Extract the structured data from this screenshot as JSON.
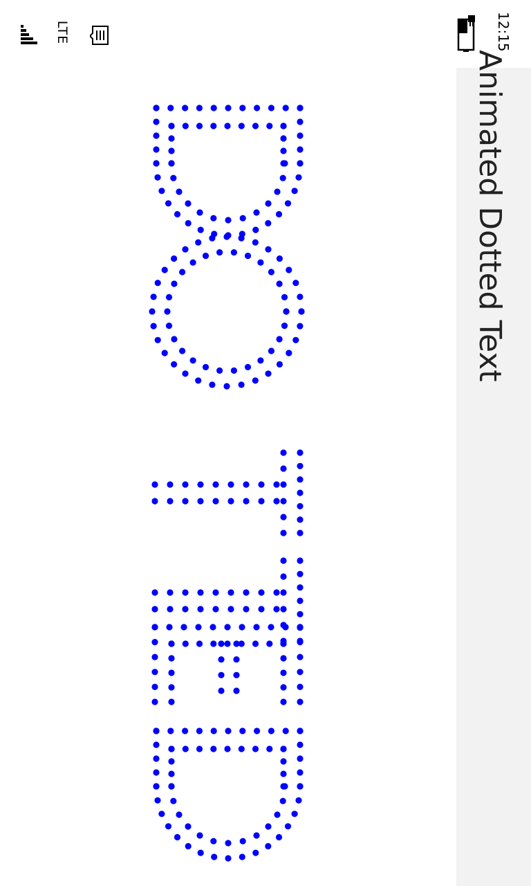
{
  "status_bar": {
    "time": "12:15",
    "network": "LTE",
    "icons": [
      "signal-strength-icon",
      "message-icon",
      "battery-charging-icon"
    ]
  },
  "header": {
    "title": "Animated Dotted Text"
  },
  "main": {
    "dotted_word": "DOTTED",
    "dot_color": "#0000ff"
  },
  "colors": {
    "header_background": "#f2f2f2",
    "page_background": "#ffffff",
    "title_text": "#222222"
  }
}
